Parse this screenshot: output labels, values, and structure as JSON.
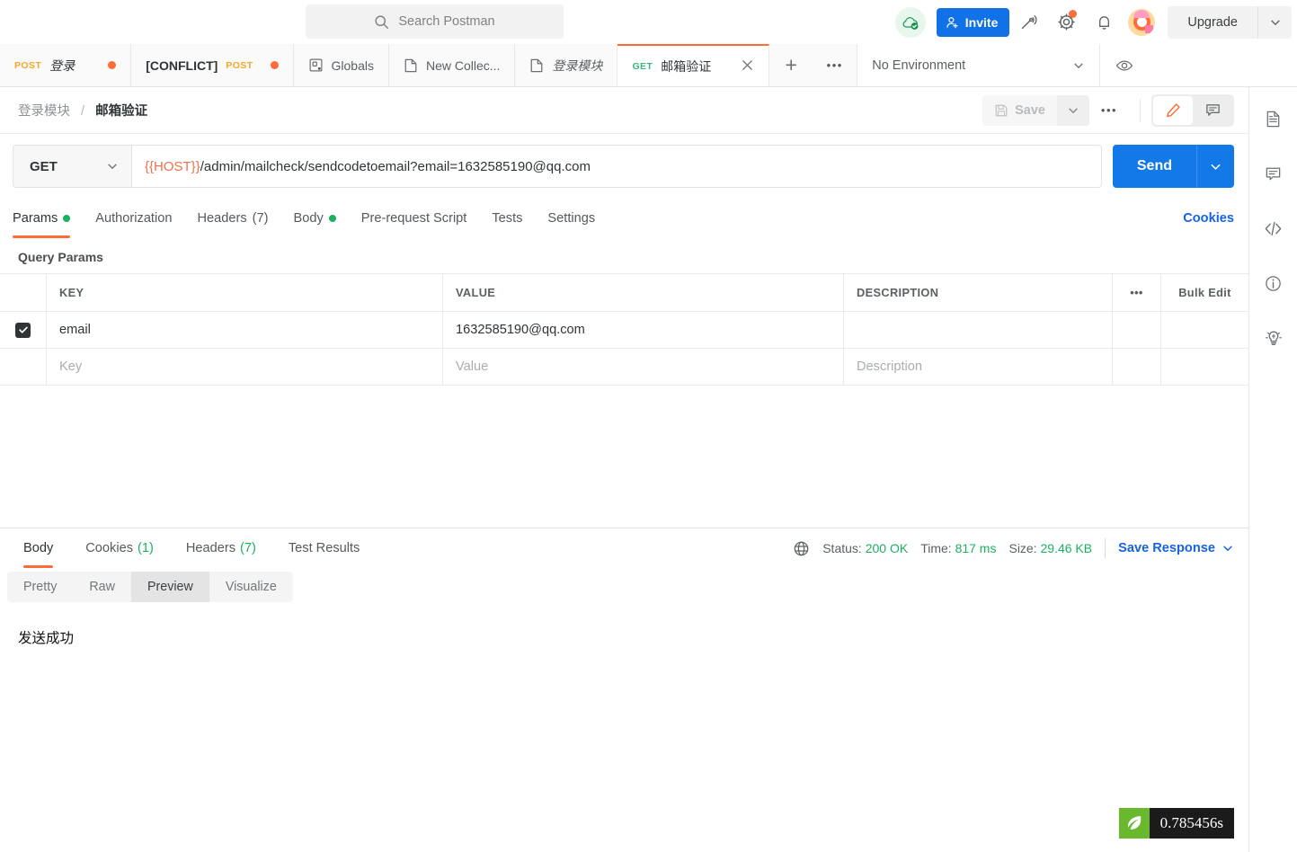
{
  "search": {
    "placeholder": "Search Postman",
    "icon": "search-icon"
  },
  "topbar": {
    "cloud_icon": "cloud-sync-icon",
    "invite_label": "Invite",
    "invite_icon": "user-plus-icon",
    "antenna_icon": "broadcast-icon",
    "settings_icon": "gear-icon",
    "notifications_icon": "bell-icon",
    "avatar_icon": "avatar",
    "upgrade_label": "Upgrade",
    "upgrade_caret": "chevron-down-icon",
    "accent_blue": "#1172e8",
    "accent_orange": "#ff6c37"
  },
  "tabs": [
    {
      "method": "POST",
      "name": "登录",
      "italic": true,
      "unsaved": true,
      "active": false,
      "icon": null
    },
    {
      "method": "POST",
      "name": "[CONFLICT]",
      "italic": false,
      "unsaved": true,
      "active": false,
      "icon": null
    },
    {
      "method": "",
      "name": "Globals",
      "italic": false,
      "unsaved": false,
      "active": false,
      "icon": "globals-icon"
    },
    {
      "method": "",
      "name": "New Collec...",
      "italic": false,
      "unsaved": false,
      "active": false,
      "icon": "collection-icon"
    },
    {
      "method": "",
      "name": "登录模块",
      "italic": true,
      "unsaved": false,
      "active": false,
      "icon": "collection-icon"
    },
    {
      "method": "GET",
      "name": "邮箱验证",
      "italic": false,
      "unsaved": false,
      "active": true,
      "icon": null
    }
  ],
  "tabbar": {
    "add_label": "+",
    "more_label": "•••",
    "environment": "No Environment",
    "env_caret": "chevron-down-icon",
    "eye_icon": "eye-icon",
    "close_icon": "close-icon"
  },
  "breadcrumb": {
    "collection": "登录模块",
    "separator": "/",
    "request": "邮箱验证"
  },
  "actions": {
    "save_label": "Save",
    "save_icon": "floppy-disk-icon",
    "save_caret": "chevron-down-icon",
    "more_label": "•••",
    "edit_icon": "pencil-icon",
    "comment_icon": "comment-icon"
  },
  "request": {
    "method": "GET",
    "method_caret": "chevron-down-icon",
    "url_variable": "{{HOST}}",
    "url_rest": "/admin/mailcheck/sendcodetoemail?email=1632585190@qq.com",
    "send_label": "Send",
    "send_caret": "chevron-down-icon"
  },
  "request_tabs": [
    {
      "label": "Params",
      "badge": "dot",
      "count": "",
      "active": true
    },
    {
      "label": "Authorization",
      "badge": "",
      "count": "",
      "active": false
    },
    {
      "label": "Headers",
      "badge": "",
      "count": "(7)",
      "active": false
    },
    {
      "label": "Body",
      "badge": "dot",
      "count": "",
      "active": false
    },
    {
      "label": "Pre-request Script",
      "badge": "",
      "count": "",
      "active": false
    },
    {
      "label": "Tests",
      "badge": "",
      "count": "",
      "active": false
    },
    {
      "label": "Settings",
      "badge": "",
      "count": "",
      "active": false
    }
  ],
  "cookies_link": "Cookies",
  "params": {
    "section_title": "Query Params",
    "columns": [
      "KEY",
      "VALUE",
      "DESCRIPTION"
    ],
    "more_label": "•••",
    "bulk_edit_label": "Bulk Edit",
    "rows": [
      {
        "checked": true,
        "key": "email",
        "value": "1632585190@qq.com",
        "description": ""
      }
    ],
    "placeholders": {
      "key": "Key",
      "value": "Value",
      "description": "Description"
    }
  },
  "response": {
    "tabs": [
      {
        "label": "Body",
        "count": "",
        "active": true
      },
      {
        "label": "Cookies",
        "count": "(1)",
        "active": false
      },
      {
        "label": "Headers",
        "count": "(7)",
        "active": false
      },
      {
        "label": "Test Results",
        "count": "",
        "active": false
      }
    ],
    "globe_icon": "globe-icon",
    "status_label": "Status:",
    "status_value": "200 OK",
    "time_label": "Time:",
    "time_value": "817 ms",
    "size_label": "Size:",
    "size_value": "29.46 KB",
    "save_response_label": "Save Response",
    "save_response_caret": "chevron-down-icon",
    "view_modes": [
      {
        "label": "Pretty",
        "active": false
      },
      {
        "label": "Raw",
        "active": false
      },
      {
        "label": "Preview",
        "active": true
      },
      {
        "label": "Visualize",
        "active": false
      }
    ],
    "body_text": "发送成功",
    "status_color": "#1cb15f"
  },
  "rail": [
    {
      "icon": "document-icon"
    },
    {
      "icon": "comment-icon"
    },
    {
      "icon": "code-icon"
    },
    {
      "icon": "info-icon"
    },
    {
      "icon": "lightbulb-icon"
    }
  ],
  "debug_widget": {
    "time": "0.785456s",
    "icon": "leaf-icon",
    "bg": "#6ab82e"
  }
}
